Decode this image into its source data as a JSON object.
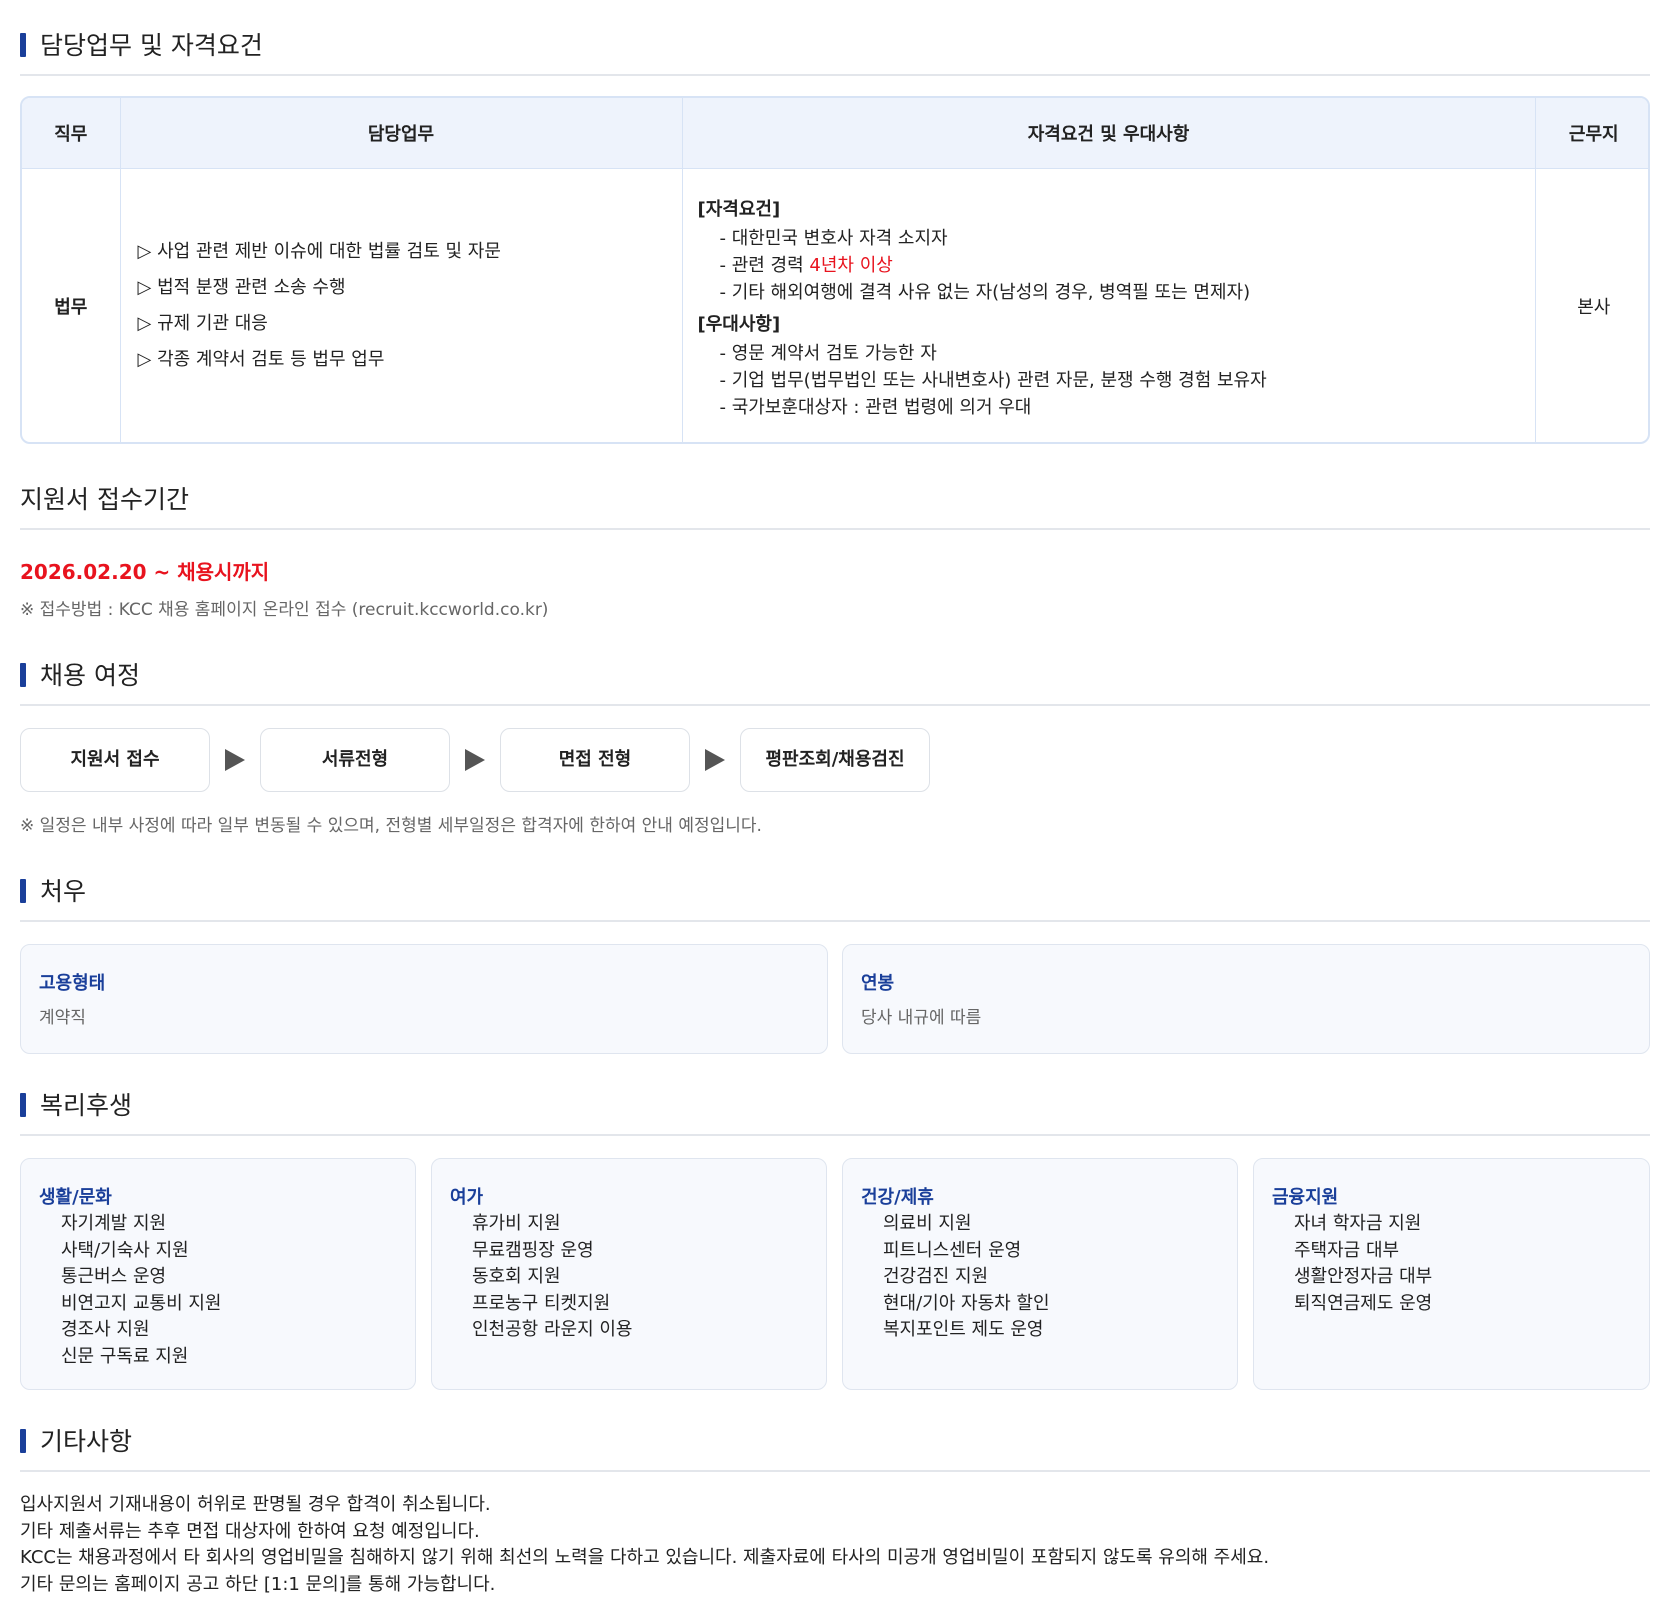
{
  "duty": {
    "title": "담당업무 및 자격요건",
    "headers": [
      "직무",
      "담당업무",
      "자격요건 및 우대사항",
      "근무지"
    ],
    "role": "법무",
    "duties": [
      "▷ 사업 관련 제반 이슈에 대한 법률 검토 및 자문",
      "▷ 법적 분쟁 관련 소송 수행",
      "▷ 규제 기관 대응",
      "▷ 각종 계약서 검토 등 법무 업무"
    ],
    "qual_head": "[자격요건]",
    "qual_1": "- 대한민국 변호사 자격 소지자",
    "qual_2_prefix": "- 관련 경력 ",
    "qual_2_highlight": "4년차 이상",
    "qual_3": "- 기타 해외여행에 결격 사유 없는 자(남성의 경우, 병역필 또는 면제자)",
    "pref_head": "[우대사항]",
    "pref_1": "- 영문 계약서 검토 가능한 자",
    "pref_2": "- 기업 법무(법무법인 또는 사내변호사) 관련 자문, 분쟁 수행 경험 보유자",
    "pref_3": "- 국가보훈대상자 : 관련 법령에 의거 우대",
    "place": "본사"
  },
  "period": {
    "title": "지원서 접수기간",
    "date": "2026.02.20 ~ 채용시까지",
    "note": "※ 접수방법 : KCC 채용 홈페이지 온라인 접수 (recruit.kccworld.co.kr)"
  },
  "process": {
    "title": "채용 여정",
    "steps": [
      "지원서 접수",
      "서류전형",
      "면접 전형",
      "평판조회/채용검진"
    ],
    "note": "※ 일정은 내부 사정에 따라 일부 변동될 수 있으며, 전형별 세부일정은 합격자에 한하여 안내 예정입니다."
  },
  "treatment": {
    "title": "처우",
    "employment_label": "고용형태",
    "employment_value": "계약직",
    "salary_label": "연봉",
    "salary_value": "당사 내규에 따름"
  },
  "welfare": {
    "title": "복리후생",
    "groups": [
      {
        "head": "생활/문화",
        "items": [
          "자기계발 지원",
          "사택/기숙사 지원",
          "통근버스 운영",
          "비연고지 교통비 지원",
          "경조사 지원",
          "신문 구독료 지원"
        ]
      },
      {
        "head": "여가",
        "items": [
          "휴가비 지원",
          "무료캠핑장 운영",
          "동호회 지원",
          "프로농구 티켓지원",
          "인천공항 라운지 이용"
        ]
      },
      {
        "head": "건강/제휴",
        "items": [
          "의료비 지원",
          "피트니스센터 운영",
          "건강검진 지원",
          "현대/기아 자동차 할인",
          "복지포인트 제도 운영"
        ]
      },
      {
        "head": "금융지원",
        "items": [
          "자녀 학자금 지원",
          "주택자금 대부",
          "생활안정자금 대부",
          "퇴직연금제도 운영"
        ]
      }
    ]
  },
  "etc": {
    "title": "기타사항",
    "lines": [
      "입사지원서 기재내용이 허위로 판명될 경우 합격이 취소됩니다.",
      "기타 제출서류는 추후 면접 대상자에 한하여 요청 예정입니다.",
      "KCC는 채용과정에서 타 회사의 영업비밀을 침해하지 않기 위해 최선의 노력을 다하고 있습니다. 제출자료에 타사의 미공개 영업비밀이 포함되지 않도록 유의해 주세요.",
      "기타 문의는 홈페이지 공고 하단 [1:1 문의]를 통해 가능합니다."
    ]
  }
}
